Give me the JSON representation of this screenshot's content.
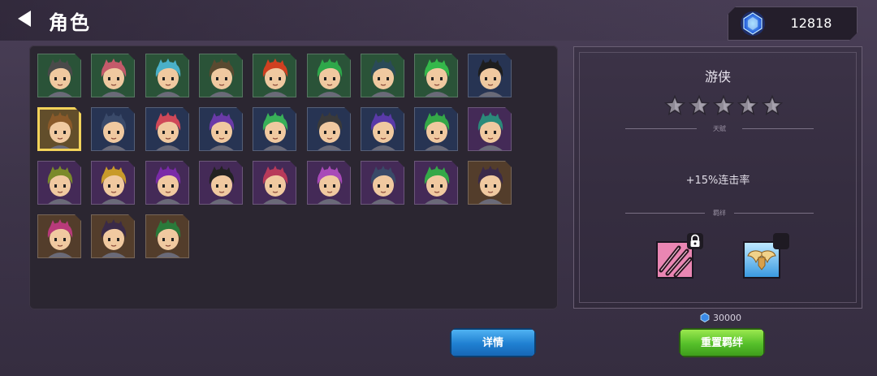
{
  "header": {
    "title": "角色",
    "currency_value": "12818"
  },
  "roster": {
    "selected_index": 9,
    "slots": [
      {
        "frame": "green",
        "hair": "#4a4a4a"
      },
      {
        "frame": "green",
        "hair": "#c45a6a"
      },
      {
        "frame": "green",
        "hair": "#4ab0c8"
      },
      {
        "frame": "green",
        "hair": "#5a4a30"
      },
      {
        "frame": "green",
        "hair": "#d04020"
      },
      {
        "frame": "green",
        "hair": "#2ea84a"
      },
      {
        "frame": "green",
        "hair": "#2a4a58"
      },
      {
        "frame": "green",
        "hair": "#34b84a"
      },
      {
        "frame": "blue",
        "hair": "#1e1e1e"
      },
      {
        "frame": "gold",
        "hair": "#8a5a2a"
      },
      {
        "frame": "blue",
        "hair": "#3a4a6a"
      },
      {
        "frame": "blue",
        "hair": "#d04858"
      },
      {
        "frame": "blue",
        "hair": "#6a3aa8"
      },
      {
        "frame": "blue",
        "hair": "#38b058"
      },
      {
        "frame": "blue",
        "hair": "#3a3a3a"
      },
      {
        "frame": "blue",
        "hair": "#5a3aa8"
      },
      {
        "frame": "blue",
        "hair": "#34a848"
      },
      {
        "frame": "purple",
        "hair": "#2a8a7a"
      },
      {
        "frame": "purple",
        "hair": "#7a8a2a"
      },
      {
        "frame": "purple",
        "hair": "#c89a2a"
      },
      {
        "frame": "purple",
        "hair": "#7a2aa8"
      },
      {
        "frame": "purple",
        "hair": "#222222"
      },
      {
        "frame": "purple",
        "hair": "#b83a5a"
      },
      {
        "frame": "purple",
        "hair": "#a84ab8"
      },
      {
        "frame": "purple",
        "hair": "#3a4a68"
      },
      {
        "frame": "purple",
        "hair": "#34a848"
      },
      {
        "frame": "brown",
        "hair": "#3a2a4a"
      },
      {
        "frame": "brown",
        "hair": "#b83a7a"
      },
      {
        "frame": "brown",
        "hair": "#3a2a48"
      },
      {
        "frame": "brown",
        "hair": "#2a7a3a"
      }
    ]
  },
  "detail": {
    "hero_name": "游侠",
    "stars": 5,
    "talent_label": "天赋",
    "talent_text": "+15%连击率",
    "bond_label": "羁绊"
  },
  "actions": {
    "reset_cost": "30000",
    "details_label": "详情",
    "reset_label": "重置羁绊"
  },
  "colors": {
    "frame_green": "#1f4a2e",
    "frame_blue": "#1c2a4a",
    "frame_purple": "#3a1f4e",
    "frame_brown": "#4a3320",
    "frame_gold": "#f2d35a",
    "accent_blue": "#1f7fd1",
    "accent_green": "#55bf2a"
  }
}
